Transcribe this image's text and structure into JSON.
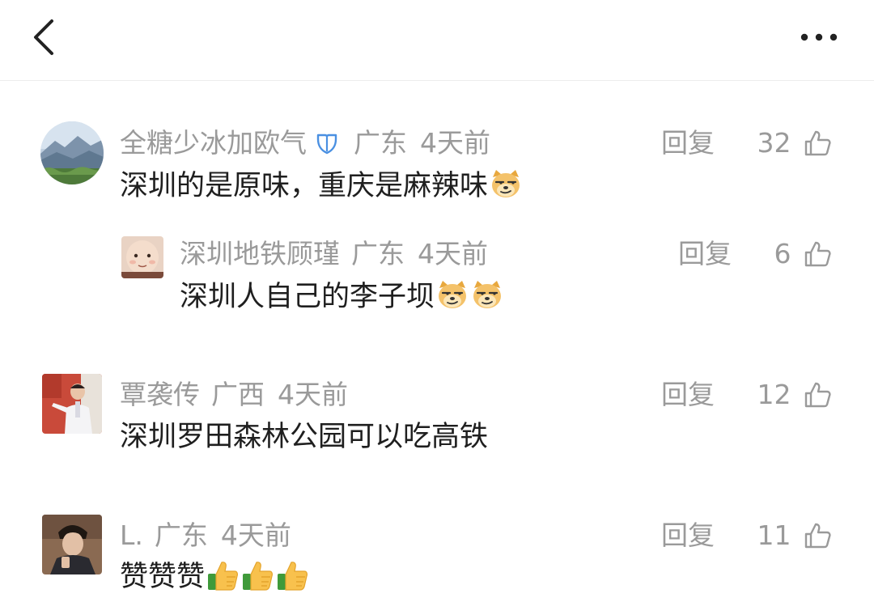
{
  "header": {
    "back_icon": "chevron-left-icon",
    "more_icon": "more-horizontal-icon"
  },
  "comments": [
    {
      "author": "全糖少冰加欧气",
      "verified_icon": "verified-badge-icon",
      "region": "广东",
      "time": "4天前",
      "text": "深圳的是原味，重庆是麻辣味",
      "emojis": [
        "doge-emoji"
      ],
      "reply_label": "回复",
      "likes": "32",
      "avatar": "mountain-landscape-avatar",
      "is_reply": false
    },
    {
      "author": "深圳地铁顾瑾",
      "region": "广东",
      "time": "4天前",
      "text": "深圳人自己的李子坝",
      "emojis": [
        "doge-emoji",
        "doge-emoji"
      ],
      "reply_label": "回复",
      "likes": "6",
      "avatar": "baby-avatar",
      "is_reply": true
    },
    {
      "author": "覃袭传",
      "region": "广西",
      "time": "4天前",
      "text": "深圳罗田森林公园可以吃高铁",
      "emojis": [],
      "reply_label": "回复",
      "likes": "12",
      "avatar": "man-presenting-avatar",
      "is_reply": false
    },
    {
      "author": "L.",
      "region": "广东",
      "time": "4天前",
      "text": "赞赞赞",
      "emojis": [
        "thumbs-up-emoji",
        "thumbs-up-emoji",
        "thumbs-up-emoji"
      ],
      "reply_label": "回复",
      "likes": "11",
      "avatar": "young-man-avatar",
      "is_reply": false
    }
  ],
  "colors": {
    "meta_text": "#9a9a9a",
    "body_text": "#1f1f1f",
    "verified_badge": "#4a90e2",
    "divider": "#ececec"
  }
}
